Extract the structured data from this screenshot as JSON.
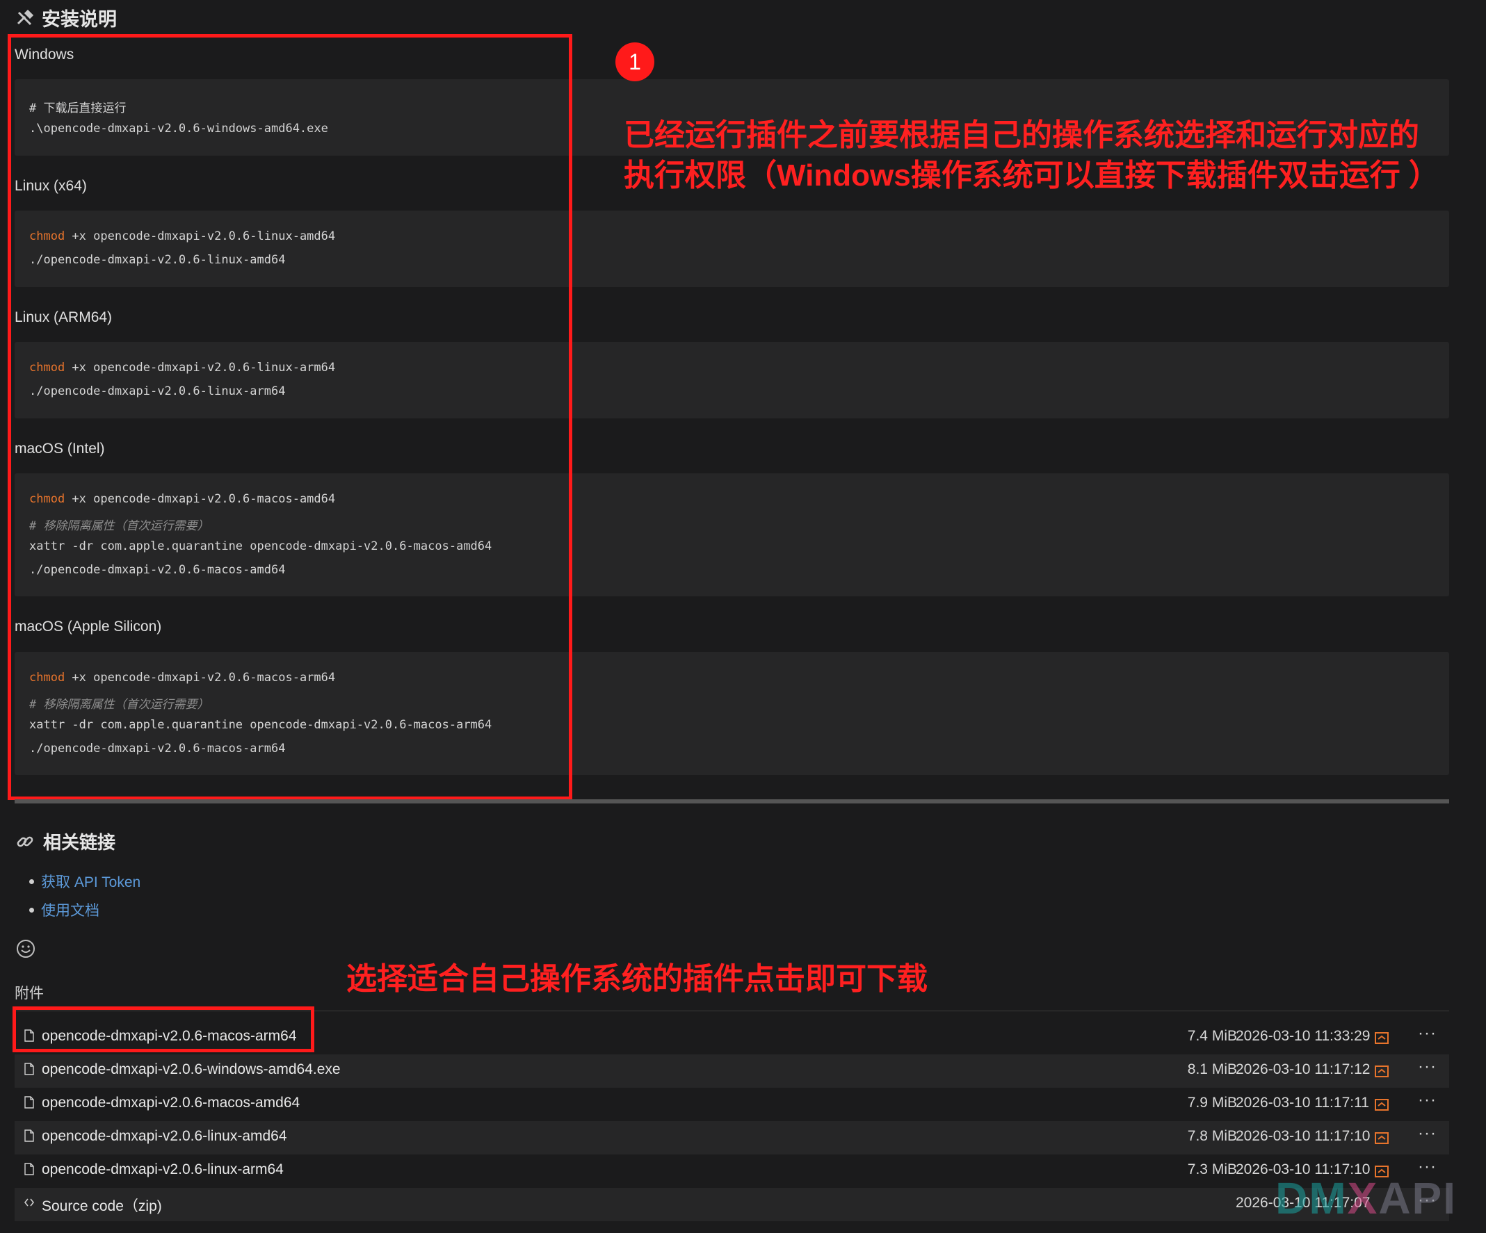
{
  "install": {
    "heading": "安装说明",
    "sections": [
      {
        "title": "Windows",
        "lines": [
          [
            {
              "t": "# 下载后直接运行",
              "c": ""
            }
          ],
          [
            {
              "t": ".\\opencode-dmxapi-v2.0.6-windows-amd64.exe",
              "c": ""
            }
          ]
        ]
      },
      {
        "title": "Linux (x64)",
        "lines": [
          [
            {
              "t": "chmod",
              "c": "kw"
            },
            {
              "t": " +x opencode-dmxapi-v2.0.6-linux-amd64",
              "c": ""
            }
          ],
          [
            {
              "t": "./opencode-dmxapi-v2.0.6-linux-amd64",
              "c": ""
            }
          ]
        ]
      },
      {
        "title": "Linux (ARM64)",
        "lines": [
          [
            {
              "t": "chmod",
              "c": "kw"
            },
            {
              "t": " +x opencode-dmxapi-v2.0.6-linux-arm64",
              "c": ""
            }
          ],
          [
            {
              "t": "./opencode-dmxapi-v2.0.6-linux-arm64",
              "c": ""
            }
          ]
        ]
      },
      {
        "title": "macOS (Intel)",
        "lines": [
          [
            {
              "t": "chmod",
              "c": "kw"
            },
            {
              "t": " +x opencode-dmxapi-v2.0.6-macos-amd64",
              "c": ""
            }
          ],
          [
            {
              "t": "# 移除隔离属性（首次运行需要）",
              "c": "cm"
            }
          ],
          [
            {
              "t": "xattr -dr com.apple.quarantine opencode-dmxapi-v2.0.6-macos-amd64",
              "c": ""
            }
          ],
          [
            {
              "t": "./opencode-dmxapi-v2.0.6-macos-amd64",
              "c": ""
            }
          ]
        ]
      },
      {
        "title": "macOS (Apple Silicon)",
        "lines": [
          [
            {
              "t": "chmod",
              "c": "kw"
            },
            {
              "t": " +x opencode-dmxapi-v2.0.6-macos-arm64",
              "c": ""
            }
          ],
          [
            {
              "t": "# 移除隔离属性（首次运行需要）",
              "c": "cm"
            }
          ],
          [
            {
              "t": "xattr -dr com.apple.quarantine opencode-dmxapi-v2.0.6-macos-arm64",
              "c": ""
            }
          ],
          [
            {
              "t": "./opencode-dmxapi-v2.0.6-macos-arm64",
              "c": ""
            }
          ]
        ]
      }
    ]
  },
  "annotations": {
    "badge": "1",
    "note_line1": "已经运行插件之前要根据自己的操作系统选择和运行对应的",
    "note_line2": "执行权限（Windows操作系统可以直接下载插件双击运行 ）",
    "download_note": "选择适合自己操作系统的插件点击即可下载"
  },
  "links": {
    "heading": "相关链接",
    "items": [
      "获取 API Token",
      "使用文档"
    ]
  },
  "attachments": {
    "heading": "附件",
    "files": [
      {
        "name": "opencode-dmxapi-v2.0.6-macos-arm64",
        "size": "7.4 MiB",
        "date": "2026-03-10 11:33:29",
        "kind": "file"
      },
      {
        "name": "opencode-dmxapi-v2.0.6-windows-amd64.exe",
        "size": "8.1 MiB",
        "date": "2026-03-10 11:17:12",
        "kind": "file"
      },
      {
        "name": "opencode-dmxapi-v2.0.6-macos-amd64",
        "size": "7.9 MiB",
        "date": "2026-03-10 11:17:11",
        "kind": "file"
      },
      {
        "name": "opencode-dmxapi-v2.0.6-linux-amd64",
        "size": "7.8 MiB",
        "date": "2026-03-10 11:17:10",
        "kind": "file"
      },
      {
        "name": "opencode-dmxapi-v2.0.6-linux-arm64",
        "size": "7.3 MiB",
        "date": "2026-03-10 11:17:10",
        "kind": "file"
      },
      {
        "name": "Source code（zip)",
        "size": "",
        "date": "2026-03-10 11:17:07",
        "kind": "source"
      }
    ],
    "more_label": "···"
  },
  "watermark": {
    "text": "DMXAPI",
    "colors": [
      "#1aa3a0",
      "#d94b8a",
      "#7a7a8a"
    ]
  },
  "colors": {
    "accent_red": "#ff1a1a",
    "link": "#5d9bdb",
    "keyword": "#e8742c"
  }
}
